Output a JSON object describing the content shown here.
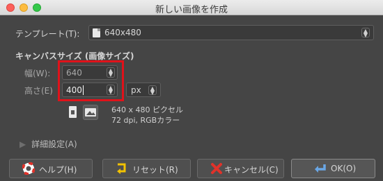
{
  "window": {
    "title": "新しい画像を作成"
  },
  "template": {
    "label": "テンプレート(T):",
    "value": "640x480"
  },
  "canvas_size": {
    "heading": "キャンバスサイズ (画像サイズ)",
    "width_label": "幅(W):",
    "width_value": "640",
    "height_label": "高さ(E)",
    "height_value": "400",
    "unit": "px",
    "info_line1": "640 x 480 ピクセル",
    "info_line2": "72 dpi, RGBカラー"
  },
  "advanced": {
    "label": "詳細設定(A)"
  },
  "buttons": {
    "help": "ヘルプ(H)",
    "reset": "リセット(R)",
    "cancel": "キャンセル(C)",
    "ok": "OK(O)"
  },
  "colors": {
    "highlight": "#e0121a",
    "background": "#454545"
  },
  "icons": [
    "file-icon",
    "portrait-icon",
    "landscape-icon",
    "lifebuoy-icon",
    "reset-arrow-icon",
    "cancel-x-icon",
    "ok-arrow-icon",
    "triangle-right-icon"
  ]
}
